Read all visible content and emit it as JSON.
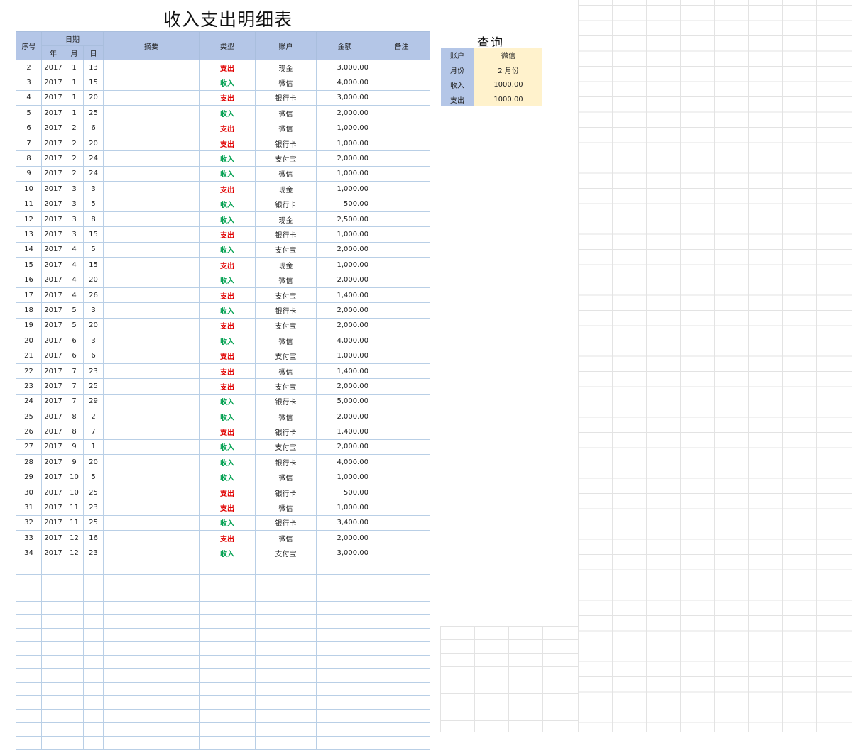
{
  "title": "收入支出明细表",
  "headers": {
    "seq": "序号",
    "date": "日期",
    "year": "年",
    "month": "月",
    "day": "日",
    "summary": "摘要",
    "type": "类型",
    "account": "账户",
    "amount": "金额",
    "note": "备注"
  },
  "rows": [
    {
      "seq": "2",
      "year": "2017",
      "month": "1",
      "day": "13",
      "type": "支出",
      "account": "现金",
      "amount": "3,000.00"
    },
    {
      "seq": "3",
      "year": "2017",
      "month": "1",
      "day": "15",
      "type": "收入",
      "account": "微信",
      "amount": "4,000.00"
    },
    {
      "seq": "4",
      "year": "2017",
      "month": "1",
      "day": "20",
      "type": "支出",
      "account": "银行卡",
      "amount": "3,000.00"
    },
    {
      "seq": "5",
      "year": "2017",
      "month": "1",
      "day": "25",
      "type": "收入",
      "account": "微信",
      "amount": "2,000.00"
    },
    {
      "seq": "6",
      "year": "2017",
      "month": "2",
      "day": "6",
      "type": "支出",
      "account": "微信",
      "amount": "1,000.00"
    },
    {
      "seq": "7",
      "year": "2017",
      "month": "2",
      "day": "20",
      "type": "支出",
      "account": "银行卡",
      "amount": "1,000.00"
    },
    {
      "seq": "8",
      "year": "2017",
      "month": "2",
      "day": "24",
      "type": "收入",
      "account": "支付宝",
      "amount": "2,000.00"
    },
    {
      "seq": "9",
      "year": "2017",
      "month": "2",
      "day": "24",
      "type": "收入",
      "account": "微信",
      "amount": "1,000.00"
    },
    {
      "seq": "10",
      "year": "2017",
      "month": "3",
      "day": "3",
      "type": "支出",
      "account": "现金",
      "amount": "1,000.00"
    },
    {
      "seq": "11",
      "year": "2017",
      "month": "3",
      "day": "5",
      "type": "收入",
      "account": "银行卡",
      "amount": "500.00"
    },
    {
      "seq": "12",
      "year": "2017",
      "month": "3",
      "day": "8",
      "type": "收入",
      "account": "现金",
      "amount": "2,500.00"
    },
    {
      "seq": "13",
      "year": "2017",
      "month": "3",
      "day": "15",
      "type": "支出",
      "account": "银行卡",
      "amount": "1,000.00"
    },
    {
      "seq": "14",
      "year": "2017",
      "month": "4",
      "day": "5",
      "type": "收入",
      "account": "支付宝",
      "amount": "2,000.00"
    },
    {
      "seq": "15",
      "year": "2017",
      "month": "4",
      "day": "15",
      "type": "支出",
      "account": "现金",
      "amount": "1,000.00"
    },
    {
      "seq": "16",
      "year": "2017",
      "month": "4",
      "day": "20",
      "type": "收入",
      "account": "微信",
      "amount": "2,000.00"
    },
    {
      "seq": "17",
      "year": "2017",
      "month": "4",
      "day": "26",
      "type": "支出",
      "account": "支付宝",
      "amount": "1,400.00"
    },
    {
      "seq": "18",
      "year": "2017",
      "month": "5",
      "day": "3",
      "type": "收入",
      "account": "银行卡",
      "amount": "2,000.00"
    },
    {
      "seq": "19",
      "year": "2017",
      "month": "5",
      "day": "20",
      "type": "支出",
      "account": "支付宝",
      "amount": "2,000.00"
    },
    {
      "seq": "20",
      "year": "2017",
      "month": "6",
      "day": "3",
      "type": "收入",
      "account": "微信",
      "amount": "4,000.00"
    },
    {
      "seq": "21",
      "year": "2017",
      "month": "6",
      "day": "6",
      "type": "支出",
      "account": "支付宝",
      "amount": "1,000.00"
    },
    {
      "seq": "22",
      "year": "2017",
      "month": "7",
      "day": "23",
      "type": "支出",
      "account": "微信",
      "amount": "1,400.00"
    },
    {
      "seq": "23",
      "year": "2017",
      "month": "7",
      "day": "25",
      "type": "支出",
      "account": "支付宝",
      "amount": "2,000.00"
    },
    {
      "seq": "24",
      "year": "2017",
      "month": "7",
      "day": "29",
      "type": "收入",
      "account": "银行卡",
      "amount": "5,000.00"
    },
    {
      "seq": "25",
      "year": "2017",
      "month": "8",
      "day": "2",
      "type": "收入",
      "account": "微信",
      "amount": "2,000.00"
    },
    {
      "seq": "26",
      "year": "2017",
      "month": "8",
      "day": "7",
      "type": "支出",
      "account": "银行卡",
      "amount": "1,400.00"
    },
    {
      "seq": "27",
      "year": "2017",
      "month": "9",
      "day": "1",
      "type": "收入",
      "account": "支付宝",
      "amount": "2,000.00"
    },
    {
      "seq": "28",
      "year": "2017",
      "month": "9",
      "day": "20",
      "type": "收入",
      "account": "银行卡",
      "amount": "4,000.00"
    },
    {
      "seq": "29",
      "year": "2017",
      "month": "10",
      "day": "5",
      "type": "收入",
      "account": "微信",
      "amount": "1,000.00"
    },
    {
      "seq": "30",
      "year": "2017",
      "month": "10",
      "day": "25",
      "type": "支出",
      "account": "银行卡",
      "amount": "500.00"
    },
    {
      "seq": "31",
      "year": "2017",
      "month": "11",
      "day": "23",
      "type": "支出",
      "account": "微信",
      "amount": "1,000.00"
    },
    {
      "seq": "32",
      "year": "2017",
      "month": "11",
      "day": "25",
      "type": "收入",
      "account": "银行卡",
      "amount": "3,400.00"
    },
    {
      "seq": "33",
      "year": "2017",
      "month": "12",
      "day": "16",
      "type": "支出",
      "account": "微信",
      "amount": "2,000.00"
    },
    {
      "seq": "34",
      "year": "2017",
      "month": "12",
      "day": "23",
      "type": "收入",
      "account": "支付宝",
      "amount": "3,000.00"
    }
  ],
  "type_colors": {
    "支出": "#e00000",
    "收入": "#00a050"
  },
  "query": {
    "title": "查询",
    "items": [
      {
        "label": "账户",
        "value": "微信"
      },
      {
        "label": "月份",
        "value": "2 月份"
      },
      {
        "label": "收入",
        "value": "1000.00"
      },
      {
        "label": "支出",
        "value": "1000.00"
      }
    ]
  },
  "colors": {
    "header_bg": "#b4c6e7",
    "query_value_bg": "#fff2cc",
    "border": "#b9cfe6"
  }
}
